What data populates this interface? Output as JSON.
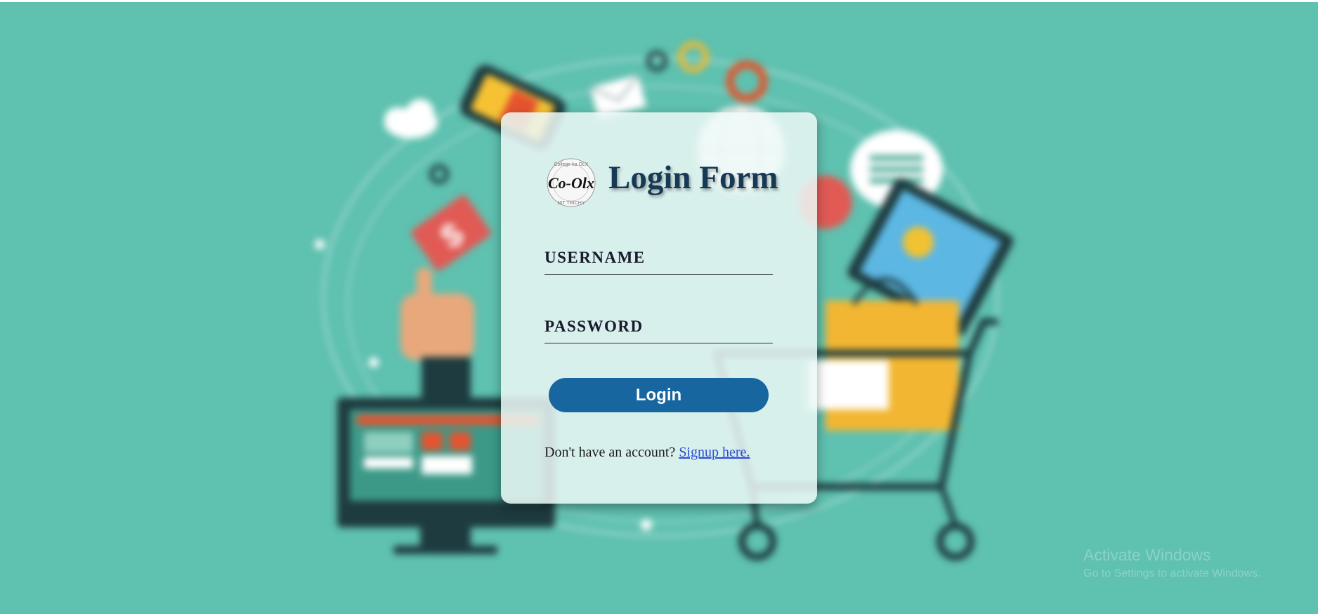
{
  "login": {
    "logo_text": "Co-Olx",
    "logo_ring_top": "College ka OLX",
    "logo_ring_bottom": "NIT TRICHY",
    "title": "Login Form",
    "username_label": "USERNAME",
    "password_label": "PASSWORD",
    "button_label": "Login",
    "signup_prompt": "Don't have an account?",
    "signup_link": "Signup here."
  },
  "watermark": {
    "line1": "Activate Windows",
    "line2": "Go to Settings to activate Windows."
  },
  "colors": {
    "background": "#5fc1b0",
    "title": "#163a55",
    "button": "#1766a0",
    "link": "#2a4bd6"
  }
}
